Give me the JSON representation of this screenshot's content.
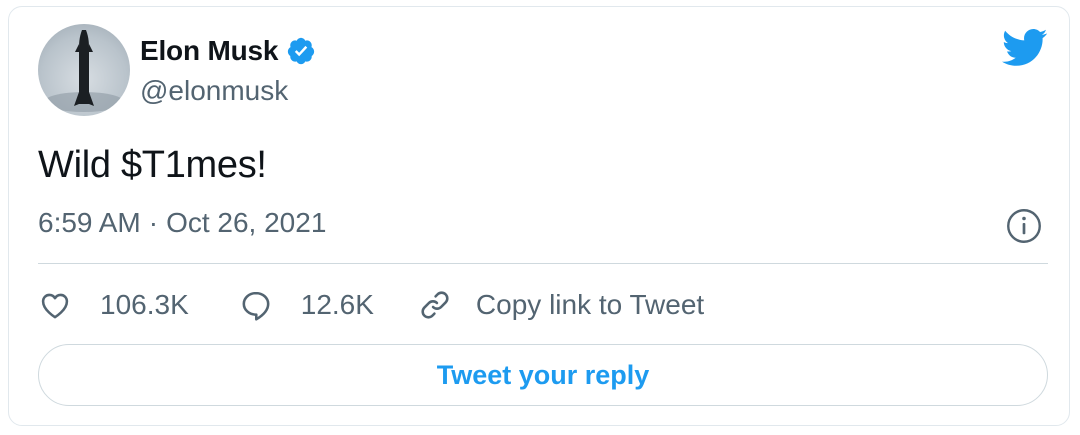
{
  "author": {
    "name": "Elon Musk",
    "handle": "@elonmusk",
    "verified": true
  },
  "tweet": {
    "text": "Wild $T1mes!",
    "time": "6:59 AM",
    "separator": "·",
    "date": "Oct 26, 2021"
  },
  "actions": {
    "likes": "106.3K",
    "replies": "12.6K",
    "copy_link": "Copy link to Tweet"
  },
  "reply_button": {
    "label": "Tweet your reply"
  },
  "icons": {
    "brand": "twitter-bird-icon",
    "verified": "verified-badge-icon",
    "info": "info-icon",
    "like": "heart-icon",
    "reply": "speech-bubble-icon",
    "copy": "link-icon"
  },
  "colors": {
    "accent": "#1d9bf0",
    "text": "#0f1419",
    "secondary": "#536471",
    "border": "#cfd9de"
  }
}
